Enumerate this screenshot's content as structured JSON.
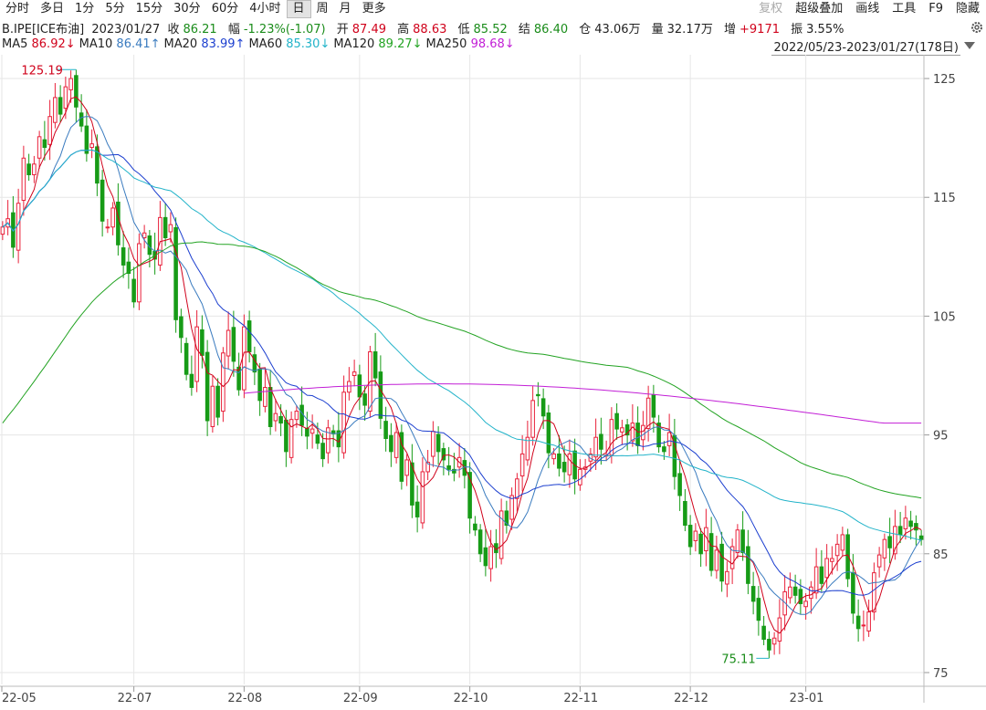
{
  "toolbar": {
    "periods": [
      "分时",
      "多日",
      "1分",
      "5分",
      "15分",
      "30分",
      "60分",
      "4小时",
      "日",
      "周",
      "月",
      "更多"
    ],
    "active": "日",
    "right": [
      {
        "label": "复权",
        "dim": true
      },
      {
        "label": "超级叠加",
        "dim": false
      },
      {
        "label": "画线",
        "dim": false
      },
      {
        "label": "工具",
        "dim": false
      },
      {
        "label": "F9",
        "dim": false
      },
      {
        "label": "隐藏",
        "dim": false
      }
    ]
  },
  "quote": {
    "symbol": "B.IPE[ICE布油]",
    "date": "2023/01/27",
    "close_label": "收",
    "close": "86.21",
    "change_label": "幅",
    "change": "-1.23%(-1.07)",
    "open_label": "开",
    "open": "87.49",
    "high_label": "高",
    "high": "88.63",
    "low_label": "低",
    "low": "85.52",
    "settle_label": "结",
    "settle": "86.40",
    "oi_label": "仓",
    "oi": "43.06万",
    "vol_label": "量",
    "vol": "32.17万",
    "inc_label": "增",
    "inc": "+9171",
    "amp_label": "振",
    "amp": "3.55%"
  },
  "ma": [
    {
      "label": "MA5",
      "value": "86.92↓",
      "color": "#d0021b"
    },
    {
      "label": "MA10",
      "value": "86.41↑",
      "color": "#3a7bbf"
    },
    {
      "label": "MA20",
      "value": "83.99↑",
      "color": "#1c3fcf"
    },
    {
      "label": "MA60",
      "value": "85.30↓",
      "color": "#22b3c9"
    },
    {
      "label": "MA120",
      "value": "89.27↓",
      "color": "#22a322"
    },
    {
      "label": "MA250",
      "value": "98.68↓",
      "color": "#c21fd6"
    }
  ],
  "range": "2022/05/23-2023/01/27(178日)",
  "chart_data": {
    "type": "candlestick",
    "y_ticks": [
      "125",
      "115",
      "105",
      "95",
      "85",
      "75"
    ],
    "ylim": [
      74,
      127
    ],
    "x_ticks": [
      "22-05",
      "22-07",
      "22-08",
      "22-09",
      "22-10",
      "22-11",
      "22-12",
      "23-01"
    ],
    "max_label": "125.19",
    "min_label": "75.11",
    "colors": {
      "up": "#e8203a",
      "down": "#179b17",
      "ma5": "#d0021b",
      "ma10": "#3a7bbf",
      "ma20": "#1c3fcf",
      "ma60": "#22b3c9",
      "ma120": "#22a322",
      "ma250": "#c21fd6",
      "grid": "#e6e6e6"
    },
    "closes": [
      112.5,
      113.2,
      110.8,
      114.5,
      118.3,
      116.9,
      117.8,
      120.1,
      119.2,
      121.8,
      123.4,
      122.0,
      124.3,
      125.0,
      122.6,
      121.0,
      118.7,
      119.5,
      116.2,
      113.0,
      112.5,
      114.1,
      111.0,
      109.3,
      108.6,
      106.2,
      111.1,
      112.0,
      110.2,
      109.8,
      113.3,
      111.6,
      112.7,
      104.7,
      103.2,
      100.1,
      99.0,
      104.1,
      101.7,
      96.2,
      99.1,
      96.5,
      101.9,
      103.8,
      101.2,
      98.8,
      104.1,
      102.0,
      100.3,
      97.9,
      99.0,
      95.7,
      96.8,
      96.0,
      93.6,
      96.3,
      97.0,
      95.8,
      94.9,
      95.5,
      94.3,
      93.0,
      95.6,
      95.1,
      94.0,
      98.6,
      99.5,
      100.3,
      98.2,
      97.5,
      102.0,
      99.8,
      96.4,
      94.7,
      93.6,
      95.2,
      91.1,
      92.9,
      89.1,
      88.1,
      91.9,
      92.7,
      95.3,
      93.6,
      92.9,
      92.1,
      91.8,
      93.1,
      91.6,
      88.0,
      87.0,
      85.0,
      84.0,
      85.6,
      85.1,
      88.6,
      87.4,
      89.9,
      91.3,
      93.4,
      94.8,
      97.9,
      98.3,
      96.6,
      93.5,
      93.4,
      92.2,
      91.9,
      93.4,
      91.3,
      92.1,
      92.3,
      93.4,
      94.8,
      93.8,
      93.3,
      96.3,
      95.5,
      95.6,
      95.0,
      96.0,
      94.1,
      95.8,
      98.1,
      96.5,
      94.0,
      93.6,
      95.2,
      91.5,
      89.9,
      87.4,
      85.6,
      86.9,
      85.0,
      87.2,
      83.6,
      85.3,
      82.7,
      83.5,
      85.6,
      87.0,
      85.1,
      82.5,
      81.0,
      79.4,
      77.8,
      76.9,
      77.9,
      79.6,
      81.8,
      82.2,
      81.5,
      80.8,
      81.0,
      82.2,
      83.9,
      82.5,
      84.6,
      84.6,
      85.8,
      86.6,
      82.9,
      80.0,
      78.7,
      79.0,
      80.1,
      83.4,
      84.9,
      86.2,
      85.5,
      87.3,
      86.6,
      88.0,
      87.3,
      87.0,
      86.2
    ],
    "ma250_start": 96.0
  }
}
